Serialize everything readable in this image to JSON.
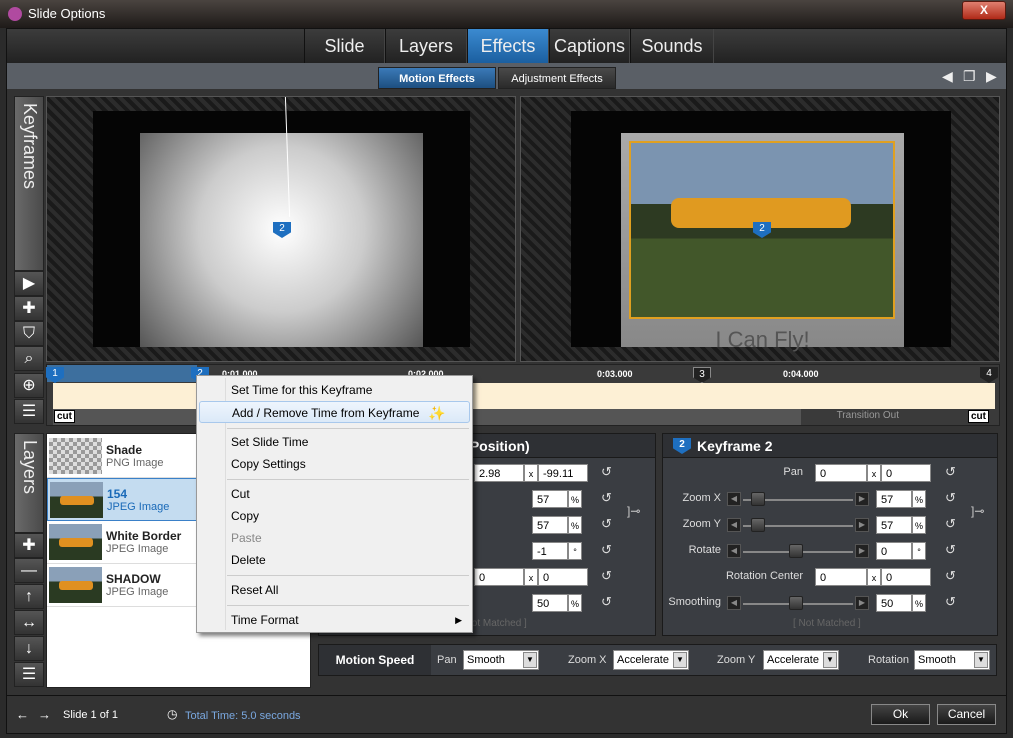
{
  "window": {
    "title": "Slide Options",
    "close_label": "X"
  },
  "tabs": [
    {
      "label": "Slide"
    },
    {
      "label": "Layers"
    },
    {
      "label": "Effects",
      "active": true
    },
    {
      "label": "Captions"
    },
    {
      "label": "Sounds"
    }
  ],
  "subtabs": [
    {
      "label": "Motion Effects",
      "active": true
    },
    {
      "label": "Adjustment Effects"
    }
  ],
  "keyframes_label": "Keyframes",
  "layers_label": "Layers",
  "preview": {
    "caption": "I Can Fly!"
  },
  "timeline": {
    "ticks": [
      "0:01.000",
      "0:02.000",
      "0:03.000",
      "0:04.000"
    ],
    "markers": [
      "1",
      "2",
      "3",
      "4"
    ],
    "cut_label": "cut",
    "transition_out": "Transition Out"
  },
  "layers": [
    {
      "name": "Shade",
      "type": "PNG Image"
    },
    {
      "name": "154",
      "type": "JPEG Image",
      "selected": true
    },
    {
      "name": "White Border",
      "type": "JPEG Image"
    },
    {
      "name": "SHADOW",
      "type": "JPEG Image"
    }
  ],
  "keyframe1": {
    "title": "Keyframe 1 (Starting Position)",
    "pan_x": "2.98",
    "pan_y": "-99.11",
    "zoom_x": "57",
    "zoom_y": "57",
    "rotate": "-1",
    "rc_x": "0",
    "rc_y": "0",
    "smoothing": "50",
    "not_matched": "[ Not Matched ]"
  },
  "keyframe2": {
    "badge": "2",
    "title": "Keyframe 2",
    "labels": {
      "pan": "Pan",
      "zoom_x": "Zoom X",
      "zoom_y": "Zoom Y",
      "rotate": "Rotate",
      "rotation_center": "Rotation Center",
      "smoothing": "Smoothing"
    },
    "pan_x": "0",
    "pan_y": "0",
    "zoom_x": "57",
    "zoom_y": "57",
    "rotate": "0",
    "rc_x": "0",
    "rc_y": "0",
    "smoothing": "50",
    "not_matched": "[ Not Matched ]"
  },
  "units": {
    "x": "x",
    "pct": "%",
    "deg": "°"
  },
  "motion_speed": {
    "label": "Motion Speed",
    "pan_label": "Pan",
    "pan": "Smooth",
    "zoomx_label": "Zoom X",
    "zoomx": "Accelerate",
    "zoomy_label": "Zoom Y",
    "zoomy": "Accelerate",
    "rotation_label": "Rotation",
    "rotation": "Smooth"
  },
  "context_menu": {
    "items": [
      "Set Time for this Keyframe",
      "Add / Remove Time from Keyframe",
      "Set Slide Time",
      "Copy Settings",
      "Cut",
      "Copy",
      "Paste",
      "Delete",
      "Reset All",
      "Time Format"
    ]
  },
  "status": {
    "slide": "Slide 1 of 1",
    "total_time": "Total Time: 5.0 seconds"
  },
  "buttons": {
    "ok": "Ok",
    "cancel": "Cancel"
  },
  "colors": {
    "accent": "#1e6fc0",
    "timeline": "#fdf0d5"
  }
}
